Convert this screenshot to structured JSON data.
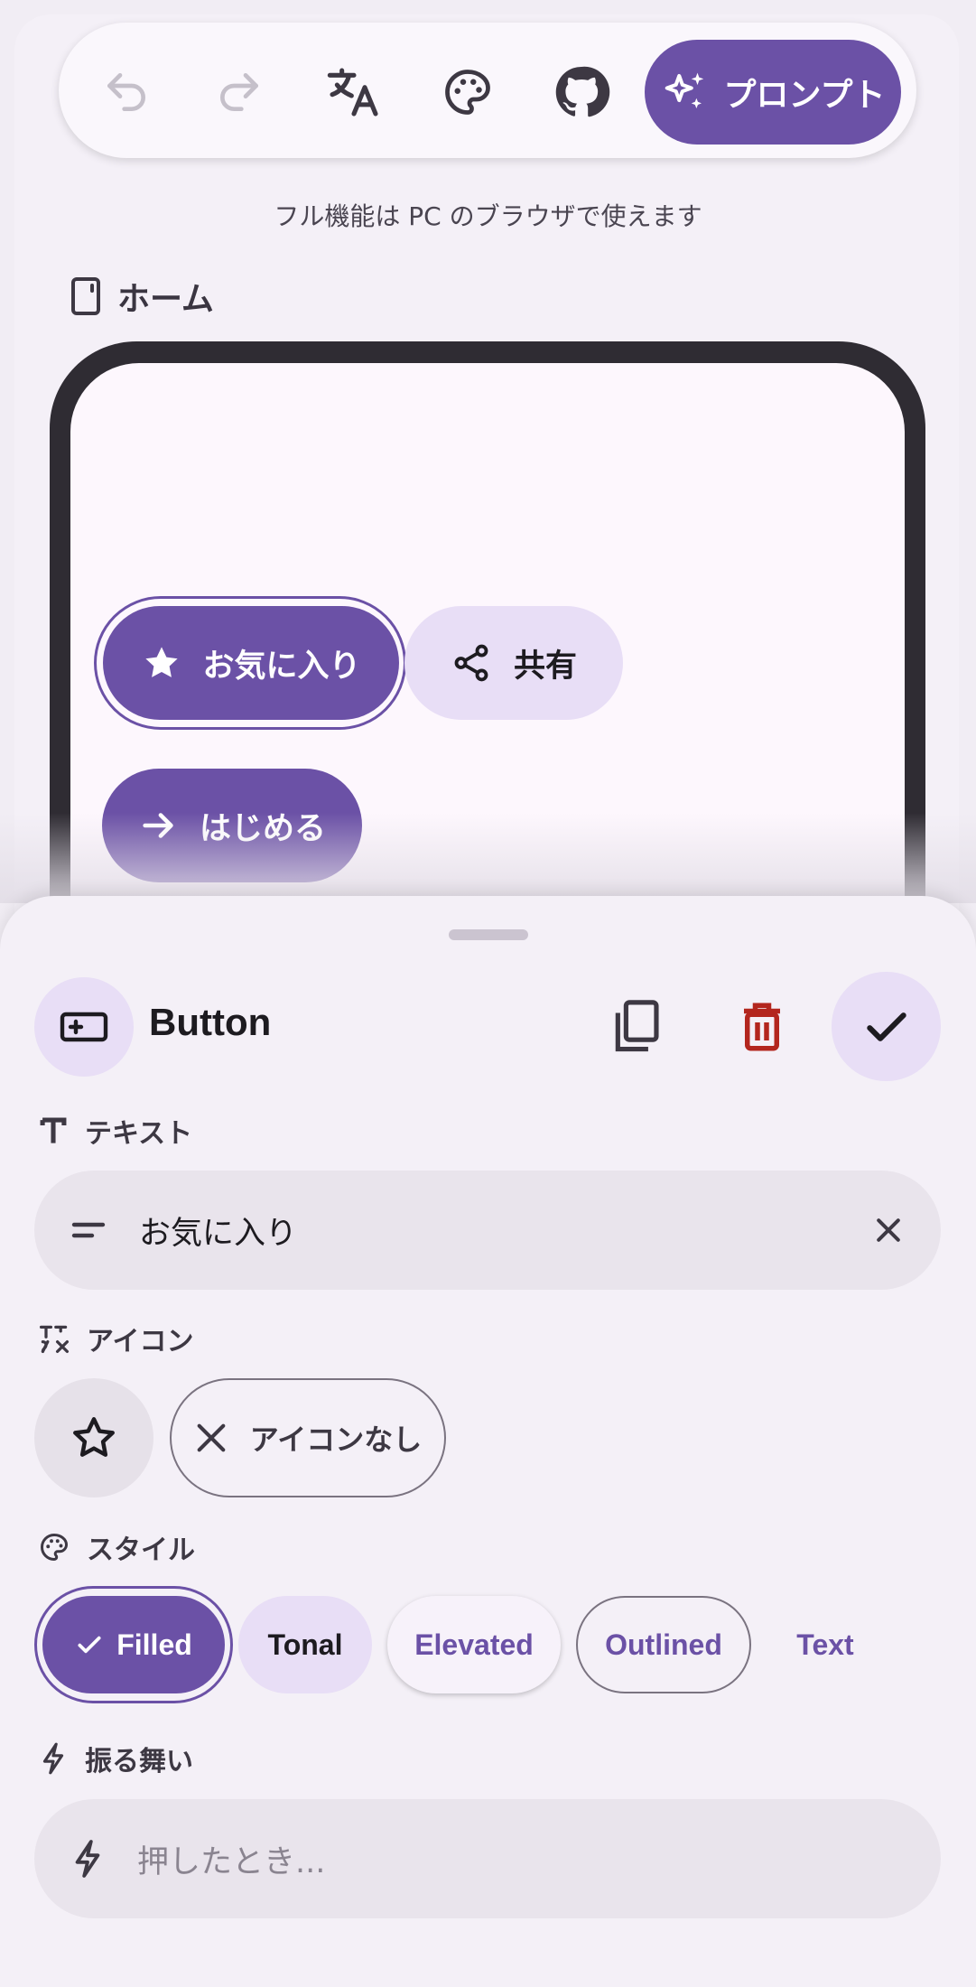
{
  "toolbar": {
    "undo_icon": "undo-icon",
    "redo_icon": "redo-icon",
    "translate_icon": "translate-icon",
    "palette_icon": "palette-icon",
    "github_icon": "github-icon",
    "prompt_label": "プロンプト"
  },
  "notice": "フル機能は PC のブラウザで使えます",
  "page": {
    "label": "ホーム"
  },
  "preview": {
    "buttons": [
      {
        "label": "お気に入り",
        "icon": "star-icon",
        "style": "filled",
        "selected": true
      },
      {
        "label": "共有",
        "icon": "share-icon",
        "style": "tonal"
      },
      {
        "label": "はじめる",
        "icon": "arrow-right-icon",
        "style": "filled"
      }
    ]
  },
  "sheet": {
    "component_title": "Button",
    "text_section": {
      "label": "テキスト",
      "value": "お気に入り"
    },
    "icon_section": {
      "label": "アイコン",
      "selected_icon": "star-icon",
      "no_icon_label": "アイコンなし"
    },
    "style_section": {
      "label": "スタイル",
      "options": [
        "Filled",
        "Tonal",
        "Elevated",
        "Outlined",
        "Text"
      ],
      "selected": "Filled"
    },
    "behavior_section": {
      "label": "振る舞い",
      "placeholder": "押したとき..."
    }
  },
  "colors": {
    "primary": "#6b51a6",
    "secondary_container": "#e8def6",
    "surface": "#f4f0f7",
    "delete": "#b3261e"
  }
}
